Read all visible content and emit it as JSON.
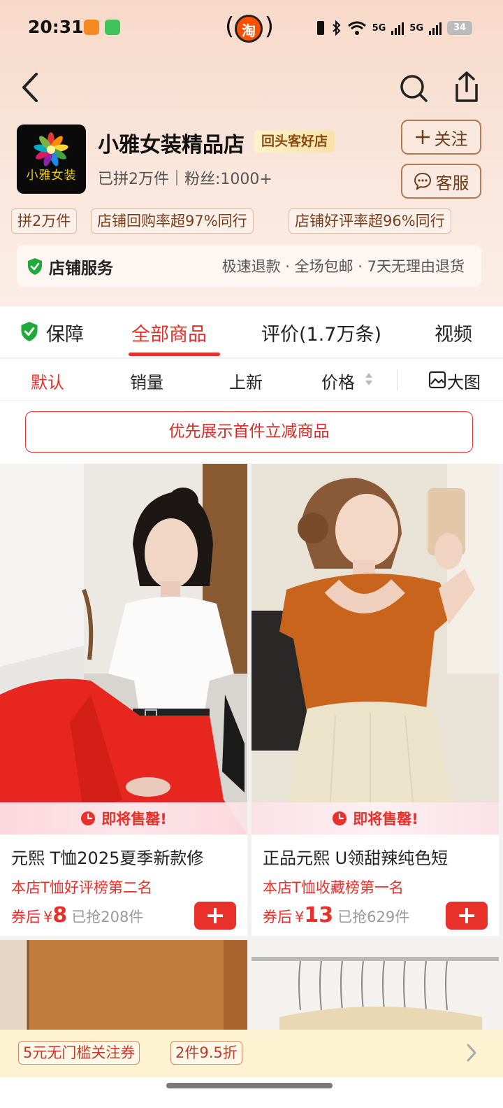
{
  "status_bar": {
    "time": "20:31",
    "taobao_badge": "淘",
    "network_1": "5G",
    "network_2": "5G",
    "battery": "34"
  },
  "shop": {
    "logo_text": "小雅女装",
    "name": "小雅女装精品店",
    "tag": "回头客好店",
    "sold": "已拼2万件",
    "fans": "粉丝:1000+",
    "follow_label": "关注",
    "service_label": "客服"
  },
  "stats": [
    "拼2万件",
    "店铺回购率超97%同行",
    "店铺好评率超96%同行"
  ],
  "service_bar": {
    "title": "店铺服务",
    "desc": "极速退款 · 全场包邮 · 7天无理由退货"
  },
  "tabs": {
    "guarantee": "保障",
    "all_products": "全部商品",
    "reviews": "评价(1.7万条)",
    "video": "视频"
  },
  "sort": {
    "default": "默认",
    "sales": "销量",
    "new": "上新",
    "price": "价格",
    "big_view": "大图"
  },
  "promo_banner": "优先展示首件立减商品",
  "products": [
    {
      "soldout_hint": "即将售罄!",
      "title": "元熙 T恤2025夏季新款修",
      "rank": "本店T恤好评榜第二名",
      "coupon_label": "券后",
      "currency": "¥",
      "price": "8",
      "sold": "已抢208件"
    },
    {
      "soldout_hint": "即将售罄!",
      "title": "正品元熙 U领甜辣纯色短",
      "rank": "本店T恤收藏榜第一名",
      "coupon_label": "券后",
      "currency": "¥",
      "price": "13",
      "sold": "已抢629件"
    }
  ],
  "bottom_bar": {
    "coupon": "5元无门槛关注券",
    "discount": "2件9.5折"
  },
  "colors": {
    "accent_red": "#e8312b",
    "header_bg": "#f7d9c9",
    "brown_outline": "#b17b52"
  }
}
